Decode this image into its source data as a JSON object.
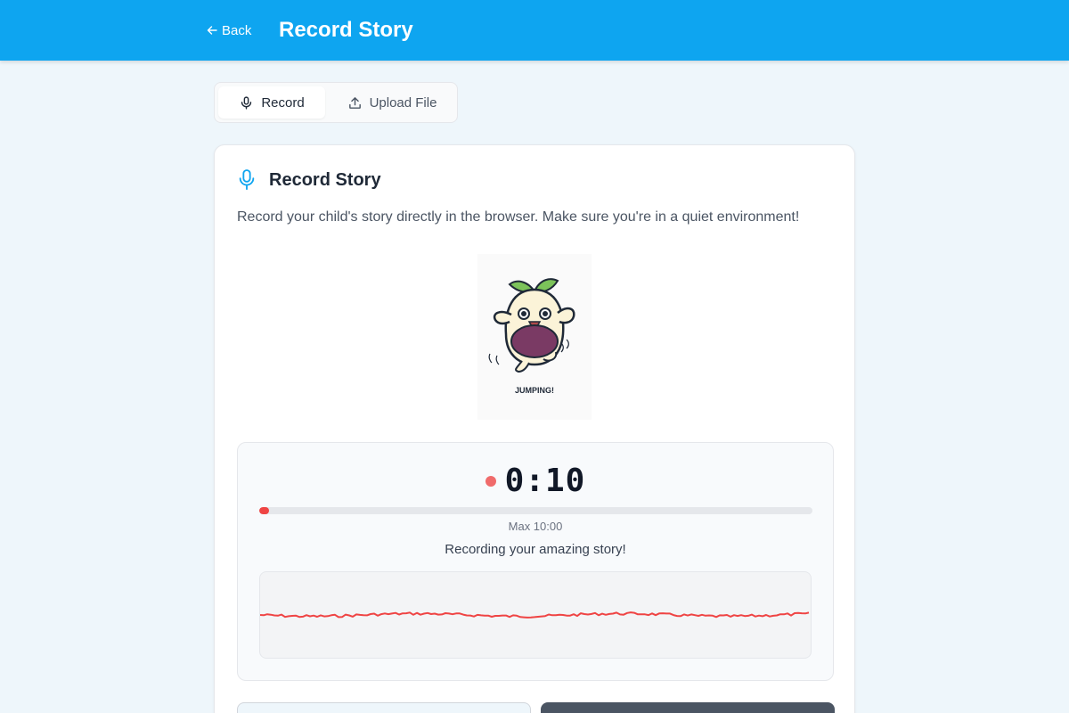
{
  "header": {
    "back_label": "Back",
    "title": "Record Story",
    "color": "#0ea5f0"
  },
  "tabs": [
    {
      "label": "Record",
      "icon": "microphone-icon",
      "selected": true
    },
    {
      "label": "Upload File",
      "icon": "upload-icon",
      "selected": false
    }
  ],
  "card": {
    "title": "Record Story",
    "icon": "microphone-icon",
    "description": "Record your child's story directly in the browser. Make sure you're in a quiet environment!"
  },
  "mascot": {
    "caption": "JUMPING!"
  },
  "recorder": {
    "timer": "0:10",
    "max_label": "Max 10:00",
    "progress_fraction": 0.0167,
    "status": "Recording your amazing story!",
    "accent": "#ef4444"
  }
}
